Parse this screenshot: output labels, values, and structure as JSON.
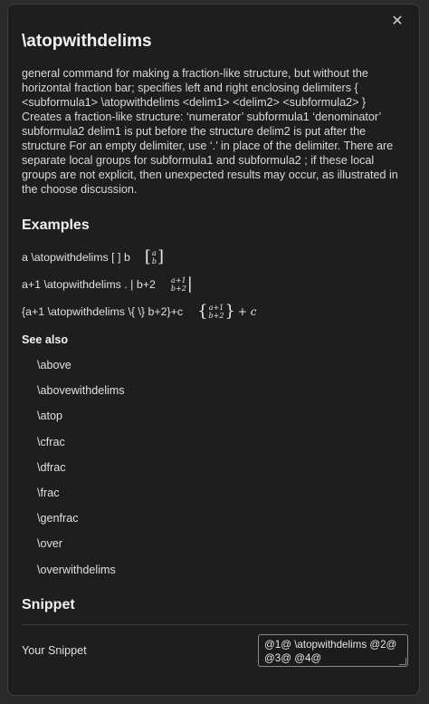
{
  "window": {
    "close_icon": "close-icon"
  },
  "title": "\\atopwithdelims",
  "description": "general command for making a fraction-like structure, but without the horizontal fraction bar; specifies left and right enclosing delimiters { <subformula1> \\atopwithdelims <delim1> <delim2> <subformula2> } Creates a fraction-like structure: ‘numerator’ subformula1 ‘denominator’ subformula2 delim1 is put before the structure delim2 is put after the structure For an empty delimiter, use ‘.’ in place of the delimiter. There are separate local groups for subformula1 and subformula2 ; if these local groups are not explicit, then unexpected results may occur, as illustrated in the choose discussion.",
  "examples": {
    "heading": "Examples",
    "rows": [
      {
        "code": "a \\atopwithdelims [ ] b",
        "left": "[",
        "num": "a",
        "den": "b",
        "right": "]",
        "tail": ""
      },
      {
        "code": "a+1 \\atopwithdelims . | b+2",
        "left": "",
        "num": "a+1",
        "den": "b+2",
        "right": "|",
        "tail": ""
      },
      {
        "code": "{a+1 \\atopwithdelims \\{ \\} b+2}+c",
        "left": "{",
        "num": "a+1",
        "den": "b+2",
        "right": "}",
        "tail": "+ c"
      }
    ]
  },
  "see_also": {
    "heading": "See also",
    "items": [
      "\\above",
      "\\abovewithdelims",
      "\\atop",
      "\\cfrac",
      "\\dfrac",
      "\\frac",
      "\\genfrac",
      "\\over",
      "\\overwithdelims"
    ]
  },
  "snippet": {
    "heading": "Snippet",
    "label": "Your Snippet",
    "value": "@1@ \\atopwithdelims @2@ @3@ @4@"
  }
}
